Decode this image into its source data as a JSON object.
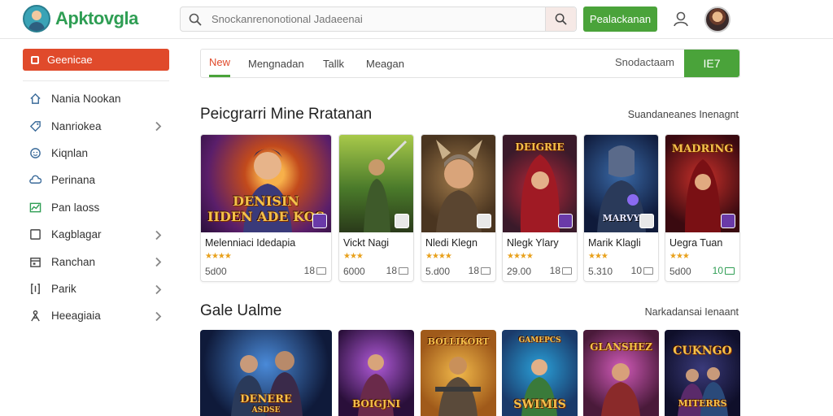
{
  "brand": {
    "name": "Apktovgla"
  },
  "search": {
    "placeholder": "Snockanrenonotional Jadaeenai"
  },
  "header": {
    "register_label": "Pealackanan"
  },
  "sidebar": {
    "active_label": "Geenicae",
    "items": [
      {
        "label": "Nania Nookan",
        "icon": "home-icon",
        "chevron": false
      },
      {
        "label": "Nanriokea",
        "icon": "tag-icon",
        "chevron": true
      },
      {
        "label": "Kiqnlan",
        "icon": "smiley-icon",
        "chevron": false
      },
      {
        "label": "Perinana",
        "icon": "cloud-icon",
        "chevron": false
      },
      {
        "label": "Pan laoss",
        "icon": "chart-icon",
        "chevron": false
      },
      {
        "label": "Kagblagar",
        "icon": "square-icon",
        "chevron": true
      },
      {
        "label": "Ranchan",
        "icon": "calendar-icon",
        "chevron": true
      },
      {
        "label": "Parik",
        "icon": "bracket-icon",
        "chevron": true
      },
      {
        "label": "Heeagiaia",
        "icon": "person-icon",
        "chevron": true
      }
    ]
  },
  "tabs": {
    "items": [
      "New",
      "Mengnadan",
      "Tallk",
      "Meagan"
    ],
    "right_label": "Snodactaam",
    "cta_label": "IE7"
  },
  "section1": {
    "title": "Peicgrarri Mine Rratanan",
    "link": "Suandaneanes Inenagnt",
    "cards": [
      {
        "title": "Melenniaci Idedapia",
        "stars": "★★★★",
        "size": "5d00",
        "count": "18",
        "highlight": false,
        "art_text": "DENISIN\nIIDEN ADE KOS"
      },
      {
        "title": "Vickt Nagi",
        "stars": "★★★",
        "size": "6000",
        "count": "18",
        "highlight": false,
        "art_text": ""
      },
      {
        "title": "Nledi Klegn",
        "stars": "★★★★",
        "size": "5.d00",
        "count": "18",
        "highlight": false,
        "art_text": ""
      },
      {
        "title": "Nlegk Ylary",
        "stars": "★★★★",
        "size": "29.00",
        "count": "18",
        "highlight": false,
        "art_text": "DEIGRIE"
      },
      {
        "title": "Marik Klagli",
        "stars": "★★★",
        "size": "5.310",
        "count": "10",
        "highlight": false,
        "art_text": "MARVY"
      },
      {
        "title": "Uegra Tuan",
        "stars": "★★★",
        "size": "5d00",
        "count": "10",
        "highlight": true,
        "art_text": "MADRING"
      }
    ]
  },
  "section2": {
    "title": "Gale Ualme",
    "link": "Narkadansai Ienaant",
    "tiles": [
      {
        "art_text": "DENERE",
        "sub_text": "ASDSE"
      },
      {
        "art_text": "BOIGJNI",
        "sub_text": ""
      },
      {
        "art_text": "BOLLIKORT",
        "sub_text": ""
      },
      {
        "art_text": "SWIMIS",
        "sub_text": "GAMEPCS"
      },
      {
        "art_text": "GLANSHEZ",
        "sub_text": ""
      },
      {
        "art_text": "CUKNGO",
        "sub_text": "MITERRS"
      }
    ]
  },
  "colors": {
    "accent_red": "#e04a2b",
    "brand_green": "#4aa33a",
    "star": "#e8a11c"
  }
}
